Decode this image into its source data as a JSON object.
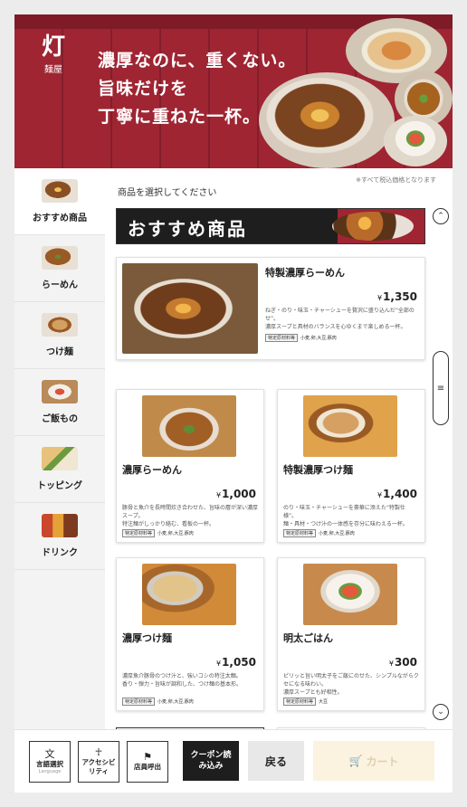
{
  "brand": {
    "logo_mark": "灯",
    "logo_sub": "麺屋"
  },
  "banner": {
    "lines": [
      "濃厚なのに、重くない。",
      "旨味だけを",
      "丁寧に重ねた一杯。"
    ]
  },
  "sidebar": {
    "items": [
      {
        "label": "おすすめ商品",
        "icon": "recommended-thumb"
      },
      {
        "label": "らーめん",
        "icon": "ramen-thumb"
      },
      {
        "label": "つけ麺",
        "icon": "tsukemen-thumb"
      },
      {
        "label": "ご飯もの",
        "icon": "rice-thumb"
      },
      {
        "label": "トッピング",
        "icon": "topping-thumb"
      },
      {
        "label": "ドリンク",
        "icon": "drink-thumb"
      }
    ]
  },
  "main": {
    "prompt": "商品を選択してください",
    "tax_note": "※すべて税込価格となります",
    "section_title": "おすすめ商品",
    "featured": {
      "name": "特製濃厚らーめん",
      "yen": "¥",
      "price": "1,350",
      "desc": "ねぎ・のり・味玉・チャーシューを贅沢に盛り込んだ“全部のせ”。\n濃厚スープと具材のバランスを心ゆくまで楽しめる一杯。",
      "allergy_tag": "特定原材料等",
      "allergy": "小麦,卵,大豆,豚肉"
    },
    "cards": [
      {
        "name": "濃厚らーめん",
        "yen": "¥",
        "price": "1,000",
        "desc": "豚骨と魚介を長時間炊き合わせた、旨味の層が深い濃厚スープ。\n特注麺がしっかり絡む、看板の一杯。",
        "allergy_tag": "特定原材料等",
        "allergy": "小麦,卵,大豆,豚肉"
      },
      {
        "name": "特製濃厚つけ麺",
        "yen": "¥",
        "price": "1,400",
        "desc": "のり・味玉・チャーシューを豪華に添えた“特製仕様”。\n麺・具材・つけ汁の一体感を存分に味わえる一杯。",
        "allergy_tag": "特定原材料等",
        "allergy": "小麦,卵,大豆,豚肉"
      },
      {
        "name": "濃厚つけ麺",
        "yen": "¥",
        "price": "1,050",
        "desc": "濃厚魚介豚骨のつけ汁と、強いコシの特注太麺。\n香り・弾力・旨味が調和した、つけ麺の基本形。",
        "allergy_tag": "特定原材料等",
        "allergy": "小麦,卵,大豆,豚肉"
      },
      {
        "name": "明太ごはん",
        "yen": "¥",
        "price": "300",
        "desc": "ピリッと旨い明太子をご飯にのせた、シンプルながらクセになる味わい。\n濃厚スープとも好相性。",
        "allergy_tag": "特定原材料等",
        "allergy": "大豆"
      }
    ]
  },
  "bottom": {
    "language": {
      "label": "言語選択",
      "sub": "Language",
      "icon": "translate-icon"
    },
    "accessibility": {
      "label": "アクセシビリティ",
      "icon": "accessibility-icon"
    },
    "call_staff": {
      "label": "店員呼出",
      "icon": "bell-icon"
    },
    "coupon": "クーポン読み込み",
    "back": "戻る",
    "cart": "カート"
  },
  "colors": {
    "brand_red": "#9f2533",
    "dark": "#1e1e1e",
    "cart_disabled_bg": "#fbf3df"
  }
}
